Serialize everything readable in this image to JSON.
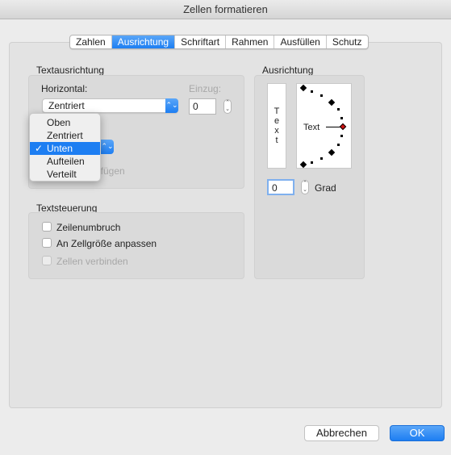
{
  "window": {
    "title": "Zellen formatieren"
  },
  "tabs": [
    {
      "label": "Zahlen"
    },
    {
      "label": "Ausrichtung"
    },
    {
      "label": "Schriftart"
    },
    {
      "label": "Rahmen"
    },
    {
      "label": "Ausfüllen"
    },
    {
      "label": "Schutz"
    }
  ],
  "active_tab": "Ausrichtung",
  "text_alignment": {
    "heading": "Textausrichtung",
    "horizontal_label": "Horizontal:",
    "horizontal_value": "Zentriert",
    "indent_label": "Einzug:",
    "indent_value": "0",
    "partial_checkbox_text": "zufügen"
  },
  "vertical_popup": {
    "options": [
      "Oben",
      "Zentriert",
      "Unten",
      "Aufteilen",
      "Verteilt"
    ],
    "selected": "Unten",
    "check": "✓"
  },
  "text_control": {
    "heading": "Textsteuerung",
    "wrap": "Zeilenumbruch",
    "shrink": "An Zellgröße anpassen",
    "merge": "Zellen verbinden"
  },
  "orientation": {
    "heading": "Ausrichtung",
    "vertical_text": [
      "T",
      "e",
      "x",
      "t"
    ],
    "dial_text": "Text",
    "degrees_value": "0",
    "degrees_label": "Grad",
    "accent": "#cc1010"
  },
  "buttons": {
    "cancel": "Abbrechen",
    "ok": "OK"
  }
}
